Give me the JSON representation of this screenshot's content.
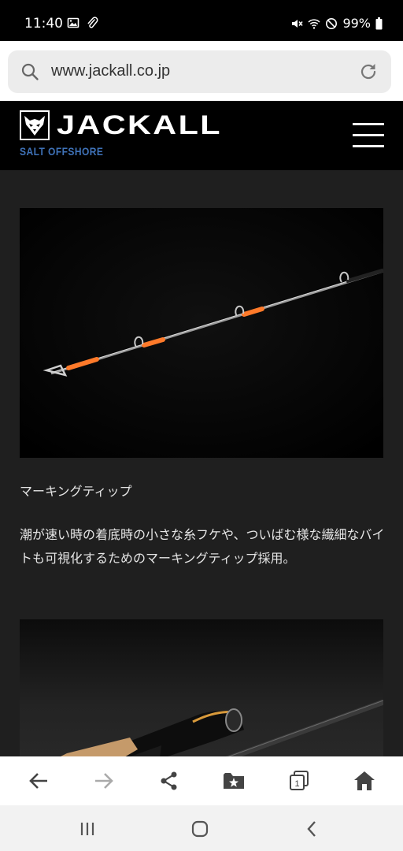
{
  "status_bar": {
    "time": "11:40",
    "battery": "99%",
    "left_icons": [
      "image-icon",
      "clip-icon"
    ],
    "right_icons": [
      "mute-icon",
      "wifi-icon",
      "no-disturb-icon",
      "battery-icon"
    ]
  },
  "browser": {
    "url": "www.jackall.co.jp"
  },
  "site_header": {
    "brand": "JACKALL",
    "subtitle": "SALT OFFSHORE"
  },
  "content": {
    "caption": "マーキングティップ",
    "description": "潮が速い時の着底時の小さな糸フケや、ついばむ様な繊細なバイトも可視化するためのマーキングティップ採用。"
  },
  "colors": {
    "subtitle": "#3f72b8",
    "content_bg": "#1f1f1f",
    "tip_accent": "#ff7a2a"
  },
  "toolbar": {
    "buttons": [
      "back-icon",
      "forward-icon",
      "share-icon",
      "bookmarks-icon",
      "tabs-icon",
      "home-icon"
    ],
    "tabs_count": "1"
  },
  "nav_bar": {
    "buttons": [
      "recent-apps-icon",
      "home-icon",
      "back-icon"
    ]
  }
}
